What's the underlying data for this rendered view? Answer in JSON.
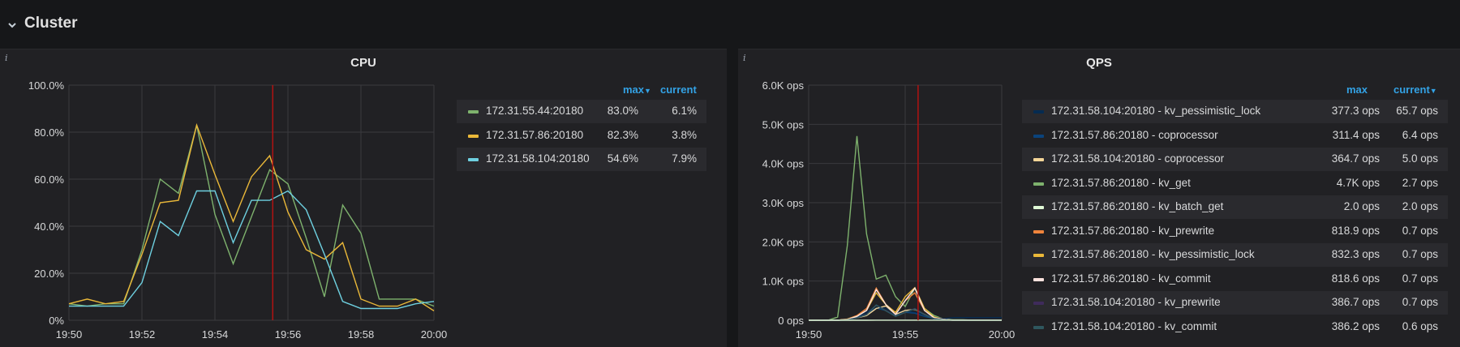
{
  "row": {
    "title": "Cluster",
    "chevron": "chevron-down-icon"
  },
  "panels": {
    "cpu": {
      "title": "CPU",
      "info_icon": "info-icon",
      "legend": {
        "col_max": "max",
        "col_current": "current",
        "sort_icon": "sort-desc-icon",
        "items": [
          {
            "name": "172.31.55.44:20180",
            "max": "83.0%",
            "current": "6.1%",
            "color": "#7eb26d"
          },
          {
            "name": "172.31.57.86:20180",
            "max": "82.3%",
            "current": "3.8%",
            "color": "#eab839"
          },
          {
            "name": "172.31.58.104:20180",
            "max": "54.6%",
            "current": "7.9%",
            "color": "#6ed0e0"
          }
        ]
      }
    },
    "qps": {
      "title": "QPS",
      "info_icon": "info-icon",
      "legend": {
        "col_max": "max",
        "col_current": "current",
        "sort_icon": "sort-desc-icon",
        "items": [
          {
            "name": "172.31.58.104:20180 - kv_pessimistic_lock",
            "max": "377.3 ops",
            "current": "65.7 ops",
            "color": "#052b51"
          },
          {
            "name": "172.31.57.86:20180 - coprocessor",
            "max": "311.4 ops",
            "current": "6.4 ops",
            "color": "#0a437c"
          },
          {
            "name": "172.31.58.104:20180 - coprocessor",
            "max": "364.7 ops",
            "current": "5.0 ops",
            "color": "#f4d598"
          },
          {
            "name": "172.31.57.86:20180 - kv_get",
            "max": "4.7K ops",
            "current": "2.7 ops",
            "color": "#7eb26d"
          },
          {
            "name": "172.31.57.86:20180 - kv_batch_get",
            "max": "2.0 ops",
            "current": "2.0 ops",
            "color": "#e0f9d7"
          },
          {
            "name": "172.31.57.86:20180 - kv_prewrite",
            "max": "818.9 ops",
            "current": "0.7 ops",
            "color": "#ef843c"
          },
          {
            "name": "172.31.57.86:20180 - kv_pessimistic_lock",
            "max": "832.3 ops",
            "current": "0.7 ops",
            "color": "#eab839"
          },
          {
            "name": "172.31.57.86:20180 - kv_commit",
            "max": "818.6 ops",
            "current": "0.7 ops",
            "color": "#fce2de"
          },
          {
            "name": "172.31.58.104:20180 - kv_prewrite",
            "max": "386.7 ops",
            "current": "0.7 ops",
            "color": "#3f2b5b"
          },
          {
            "name": "172.31.58.104:20180 - kv_commit",
            "max": "386.2 ops",
            "current": "0.6 ops",
            "color": "#2f575e"
          }
        ]
      }
    }
  },
  "chart_data": [
    {
      "type": "line",
      "title": "CPU",
      "x": [
        "19:50",
        "19:50:30",
        "19:51",
        "19:51:30",
        "19:52",
        "19:52:30",
        "19:53",
        "19:53:30",
        "19:54",
        "19:54:30",
        "19:55",
        "19:55:30",
        "19:56",
        "19:56:30",
        "19:57",
        "19:57:30",
        "19:58",
        "19:58:30",
        "19:59",
        "19:59:30",
        "20:00"
      ],
      "x_ticks": [
        "19:50",
        "19:52",
        "19:54",
        "19:56",
        "19:58",
        "20:00"
      ],
      "y_ticks": [
        "0%",
        "20.0%",
        "40.0%",
        "60.0%",
        "80.0%",
        "100.0%"
      ],
      "ylim": [
        0,
        100
      ],
      "grid": true,
      "current_time_marker": "19:55:35",
      "series": [
        {
          "name": "172.31.55.44:20180",
          "color": "#7eb26d",
          "values": [
            7,
            6,
            7,
            7,
            30,
            60,
            54,
            83,
            45,
            24,
            44,
            64,
            58,
            35,
            10,
            49,
            37,
            9,
            9,
            9,
            6
          ]
        },
        {
          "name": "172.31.57.86:20180",
          "color": "#eab839",
          "values": [
            7,
            9,
            7,
            8,
            28,
            50,
            51,
            83,
            62,
            42,
            61,
            70,
            46,
            30,
            26,
            33,
            9,
            6,
            6,
            9,
            4
          ]
        },
        {
          "name": "172.31.58.104:20180",
          "color": "#6ed0e0",
          "values": [
            6,
            6,
            6,
            6,
            16,
            42,
            36,
            55,
            55,
            33,
            51,
            51,
            55,
            47,
            28,
            8,
            5,
            5,
            5,
            7,
            8
          ]
        }
      ]
    },
    {
      "type": "line",
      "title": "QPS",
      "x": [
        "19:50",
        "19:50:30",
        "19:51",
        "19:51:30",
        "19:52",
        "19:52:30",
        "19:53",
        "19:53:30",
        "19:54",
        "19:54:30",
        "19:55",
        "19:55:30",
        "19:56",
        "19:56:30",
        "19:57",
        "19:57:30",
        "19:58",
        "19:58:30",
        "19:59",
        "19:59:30",
        "20:00"
      ],
      "x_ticks": [
        "19:50",
        "19:55",
        "20:00"
      ],
      "y_ticks": [
        "0 ops",
        "1.0K ops",
        "2.0K ops",
        "3.0K ops",
        "4.0K ops",
        "5.0K ops",
        "6.0K ops"
      ],
      "ylim": [
        0,
        6000
      ],
      "grid": true,
      "current_time_marker": "19:55:40",
      "series": [
        {
          "name": "172.31.57.86:20180 - kv_get",
          "color": "#7eb26d",
          "values": [
            0,
            0,
            0,
            80,
            1900,
            4700,
            2200,
            1050,
            1150,
            600,
            350,
            820,
            300,
            120,
            30,
            10,
            10,
            0,
            0,
            0,
            0
          ]
        },
        {
          "name": "172.31.58.104:20180 - kv_pessimistic_lock",
          "color": "#052b51",
          "values": [
            0,
            0,
            0,
            0,
            30,
            90,
            200,
            377,
            300,
            200,
            240,
            200,
            150,
            80,
            40,
            66,
            66,
            66,
            66,
            66,
            66
          ]
        },
        {
          "name": "172.31.57.86:20180 - coprocessor",
          "color": "#0a437c",
          "values": [
            0,
            0,
            0,
            0,
            20,
            80,
            150,
            311,
            250,
            120,
            200,
            180,
            100,
            40,
            10,
            6,
            6,
            6,
            6,
            6,
            6
          ]
        },
        {
          "name": "172.31.58.104:20180 - coprocessor",
          "color": "#f4d598",
          "values": [
            0,
            0,
            0,
            0,
            20,
            60,
            120,
            300,
            365,
            150,
            250,
            280,
            150,
            40,
            10,
            5,
            5,
            5,
            5,
            5,
            5
          ]
        },
        {
          "name": "172.31.57.86:20180 - kv_prewrite",
          "color": "#ef843c",
          "values": [
            0,
            0,
            0,
            0,
            30,
            120,
            300,
            819,
            400,
            150,
            500,
            700,
            250,
            60,
            20,
            1,
            1,
            1,
            1,
            1,
            1
          ]
        },
        {
          "name": "172.31.57.86:20180 - kv_pessimistic_lock",
          "color": "#eab839",
          "values": [
            0,
            0,
            0,
            0,
            30,
            100,
            250,
            700,
            400,
            200,
            600,
            832,
            300,
            80,
            20,
            1,
            1,
            1,
            1,
            1,
            1
          ]
        },
        {
          "name": "172.31.57.86:20180 - kv_commit",
          "color": "#fce2de",
          "values": [
            0,
            0,
            0,
            0,
            20,
            100,
            250,
            780,
            400,
            150,
            500,
            819,
            250,
            60,
            20,
            1,
            1,
            1,
            1,
            1,
            1
          ]
        },
        {
          "name": "172.31.58.104:20180 - kv_prewrite",
          "color": "#3f2b5b",
          "values": [
            0,
            0,
            0,
            0,
            10,
            60,
            150,
            387,
            250,
            100,
            200,
            300,
            150,
            40,
            10,
            1,
            1,
            1,
            1,
            1,
            1
          ]
        },
        {
          "name": "172.31.58.104:20180 - kv_commit",
          "color": "#2f575e",
          "values": [
            0,
            0,
            0,
            0,
            10,
            60,
            140,
            386,
            240,
            100,
            200,
            290,
            140,
            40,
            10,
            1,
            1,
            1,
            1,
            1,
            1
          ]
        },
        {
          "name": "172.31.57.86:20180 - kv_batch_get",
          "color": "#e0f9d7",
          "values": [
            0,
            0,
            0,
            0,
            0,
            1,
            1,
            2,
            2,
            2,
            2,
            2,
            2,
            2,
            2,
            2,
            2,
            2,
            2,
            2,
            2
          ]
        }
      ]
    }
  ]
}
